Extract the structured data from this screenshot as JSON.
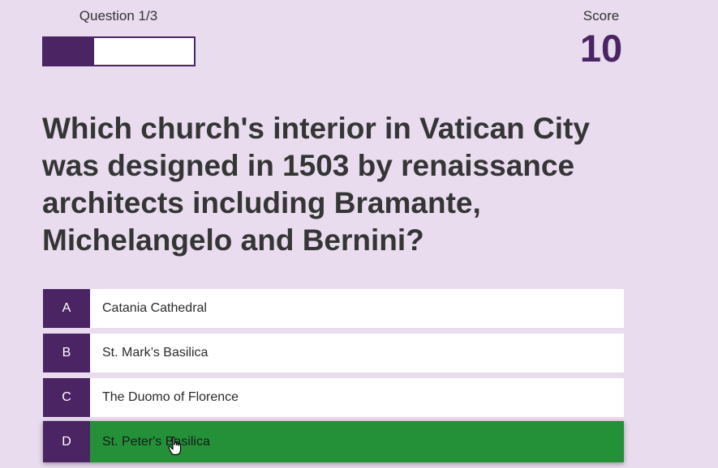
{
  "progress": {
    "label": "Question 1/3",
    "fraction": 0.333
  },
  "score": {
    "label": "Score",
    "value": "10"
  },
  "question": {
    "text": "Which church's interior in Vatican City was designed in 1503 by renaissance architects including Bramante, Michelangelo and Bernini?"
  },
  "answers": [
    {
      "letter": "A",
      "text": "Catania Cathedral"
    },
    {
      "letter": "B",
      "text": "St. Mark’s Basilica"
    },
    {
      "letter": "C",
      "text": "The Duomo of Florence"
    },
    {
      "letter": "D",
      "text": "St. Peter's Basilica"
    }
  ],
  "colors": {
    "background": "#e8dcee",
    "accent": "#4b2464",
    "correct": "#249139"
  },
  "icons": {
    "cursor": "hand-pointer-icon"
  }
}
